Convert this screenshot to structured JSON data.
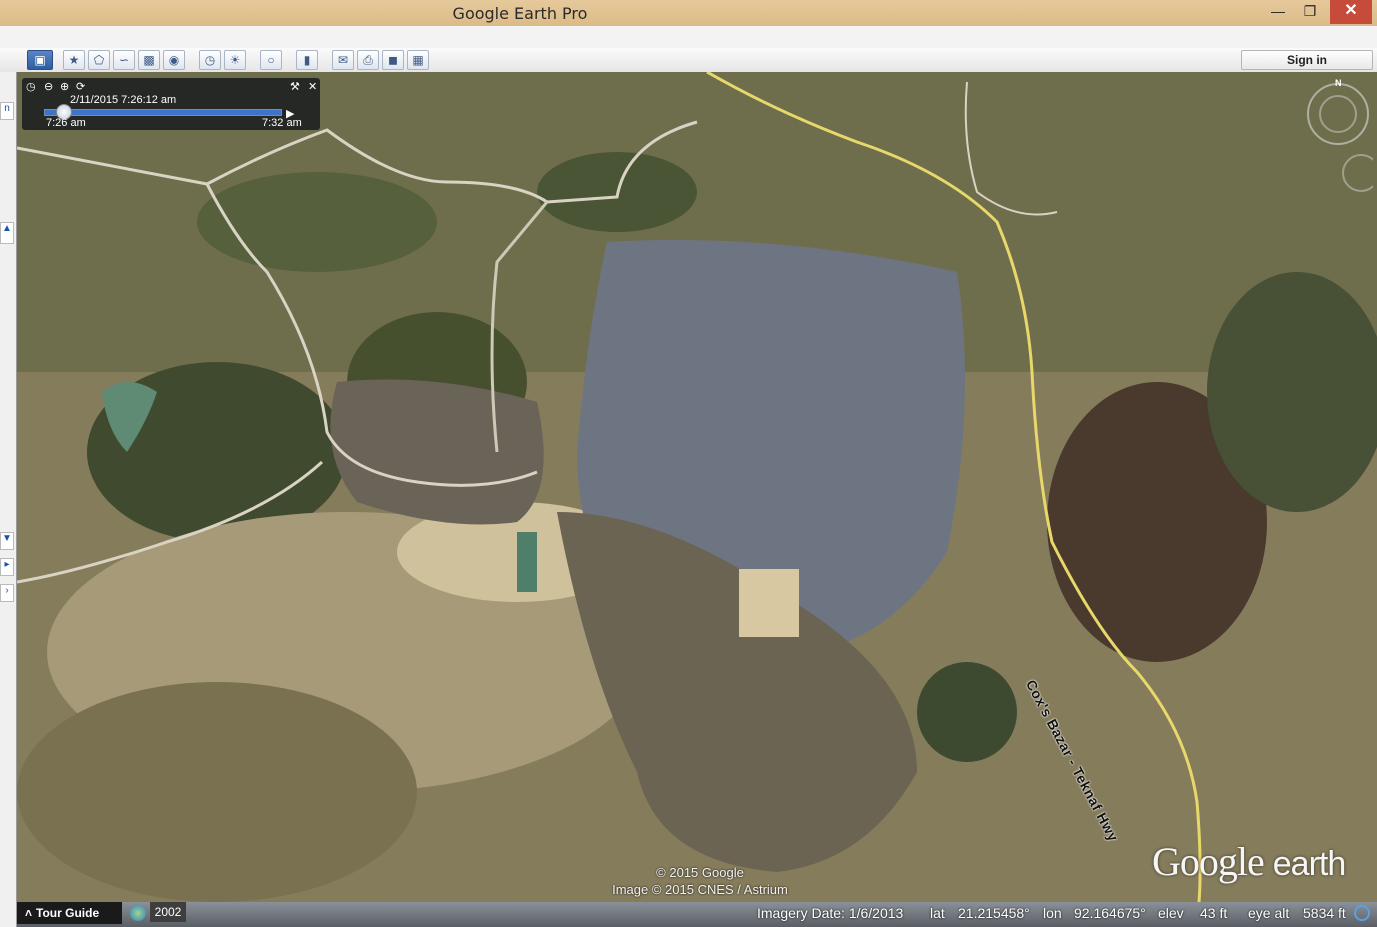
{
  "window": {
    "title": "Google Earth Pro",
    "minimize_icon": "minimize-icon",
    "maximize_icon": "maximize-icon",
    "close_icon": "close-icon"
  },
  "toolbar": {
    "buttons": [
      "sidebar-toggle-icon",
      "placemark-icon",
      "polygon-icon",
      "path-icon",
      "image-overlay-icon",
      "record-tour-icon",
      "historical-imagery-icon",
      "sunlight-icon",
      "planets-icon",
      "ruler-icon",
      "email-icon",
      "print-icon",
      "save-image-icon",
      "view-in-maps-icon"
    ],
    "sign_in_label": "Sign in"
  },
  "time_slider": {
    "current": "2/11/2015   7:26:12 am",
    "start_label": "7:26 am",
    "end_label": "7:32 am",
    "position": 0.08
  },
  "map": {
    "road_label": "Cox's Bazar - Teknaf Hwy",
    "copyright_line1": "© 2015 Google",
    "copyright_line2": "Image © 2015 CNES / Astrium",
    "logo_google": "Google",
    "logo_earth": "earth",
    "compass_north": "N"
  },
  "statusbar": {
    "tour_guide": "Tour Guide",
    "year": "2002",
    "imagery_date": "Imagery Date: 1/6/2013",
    "lat_label": "lat",
    "lat_value": "21.215458°",
    "lon_label": "lon",
    "lon_value": "92.164675°",
    "elev_label": "elev",
    "elev_value": "43 ft",
    "eye_alt_label": "eye alt",
    "eye_alt_value": "5834 ft"
  }
}
